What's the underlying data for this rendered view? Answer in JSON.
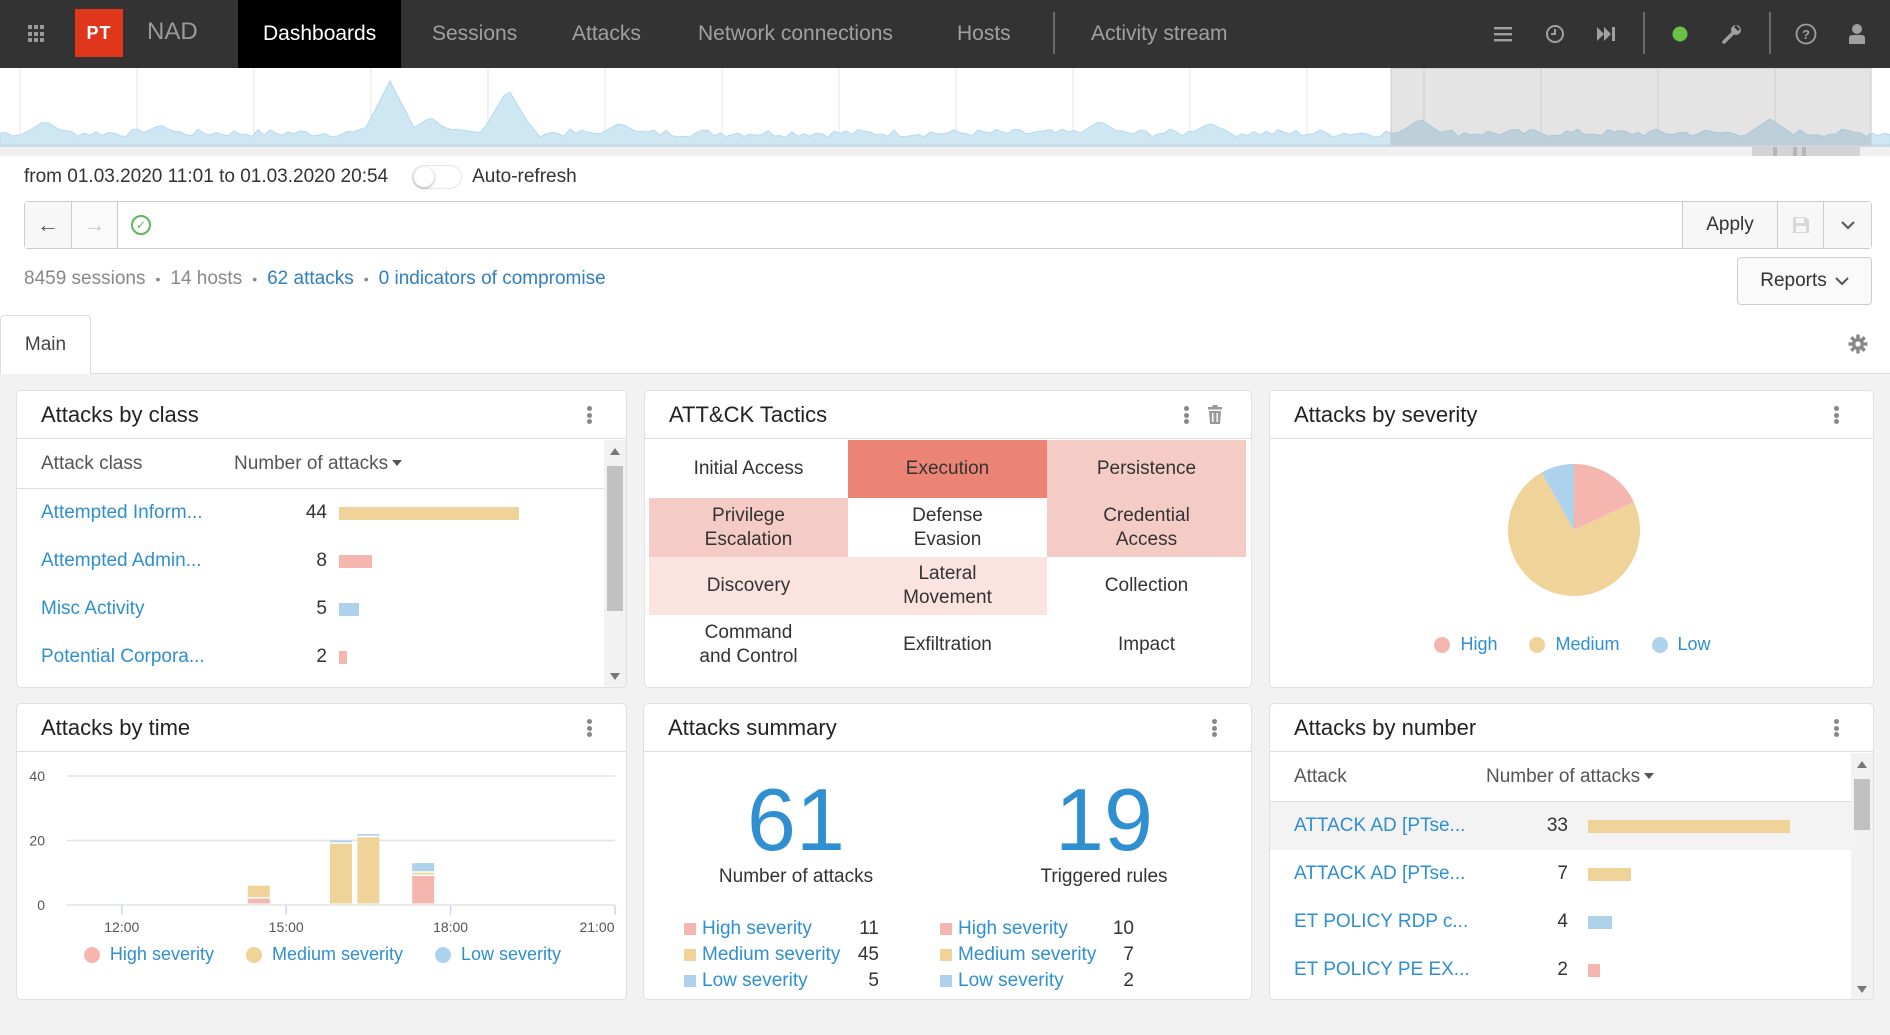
{
  "nav": {
    "app_name": "NAD",
    "logo_text": "PT",
    "tabs": [
      {
        "label": "Dashboards",
        "active": true
      },
      {
        "label": "Sessions",
        "active": false
      },
      {
        "label": "Attacks",
        "active": false
      },
      {
        "label": "Network connections",
        "active": false
      },
      {
        "label": "Hosts",
        "active": false
      },
      {
        "label": "Activity stream",
        "active": false
      }
    ],
    "icons": [
      "apps-grid-icon",
      "list-icon",
      "clock-icon",
      "skip-forward-icon",
      "status-online-icon",
      "wrench-icon",
      "help-icon",
      "user-icon"
    ],
    "status_color": "#5cb85c"
  },
  "timeline": {
    "description": "session activity overview with selected range highlighted"
  },
  "filter": {
    "date_range": "from 01.03.2020 11:01 to 01.03.2020 20:54",
    "auto_refresh_label": "Auto-refresh",
    "auto_refresh_on": false,
    "query_value": "",
    "query_placeholder": "",
    "apply_label": "Apply"
  },
  "stats": {
    "sessions": "8459 sessions",
    "hosts": "14 hosts",
    "attacks": "62 attacks",
    "ioc": "0 indicators of compromise"
  },
  "reports_label": "Reports",
  "tabs": [
    {
      "label": "Main",
      "active": true
    }
  ],
  "colors": {
    "high": "#f4b6ae",
    "medium": "#efd399",
    "low": "#aed2ec",
    "link": "#2f8fd0",
    "tactic_strong": "#eb8474",
    "tactic_mid": "#f5cbc5",
    "tactic_light": "#fbe3e0"
  },
  "panels": {
    "attacks_by_class": {
      "title": "Attacks by class",
      "col1": "Attack class",
      "col2": "Number of attacks",
      "rows": [
        {
          "name": "Attempted Inform...",
          "value": 44,
          "severity": "medium"
        },
        {
          "name": "Attempted Admin...",
          "value": 8,
          "severity": "high"
        },
        {
          "name": "Misc Activity",
          "value": 5,
          "severity": "low"
        },
        {
          "name": "Potential Corpora...",
          "value": 2,
          "severity": "high"
        }
      ]
    },
    "attck_tactics": {
      "title": "ATT&CK Tactics",
      "cells": [
        {
          "label": "Initial Access",
          "level": "none"
        },
        {
          "label": "Execution",
          "level": "strong"
        },
        {
          "label": "Persistence",
          "level": "mid"
        },
        {
          "label": "Privilege\nEscalation",
          "level": "mid"
        },
        {
          "label": "Defense\nEvasion",
          "level": "none"
        },
        {
          "label": "Credential\nAccess",
          "level": "mid"
        },
        {
          "label": "Discovery",
          "level": "light"
        },
        {
          "label": "Lateral\nMovement",
          "level": "light"
        },
        {
          "label": "Collection",
          "level": "none"
        },
        {
          "label": "Command\nand Control",
          "level": "none"
        },
        {
          "label": "Exfiltration",
          "level": "none"
        },
        {
          "label": "Impact",
          "level": "none"
        }
      ]
    },
    "attacks_by_severity": {
      "title": "Attacks by severity"
    },
    "attacks_by_time": {
      "title": "Attacks by time"
    },
    "attacks_summary": {
      "title": "Attacks summary",
      "attacks_total": "61",
      "attacks_label": "Number of attacks",
      "rules_total": "19",
      "rules_label": "Triggered rules",
      "attacks_breakdown": [
        {
          "label": "High severity",
          "value": "11",
          "severity": "high"
        },
        {
          "label": "Medium severity",
          "value": "45",
          "severity": "medium"
        },
        {
          "label": "Low severity",
          "value": "5",
          "severity": "low"
        }
      ],
      "rules_breakdown": [
        {
          "label": "High severity",
          "value": "10",
          "severity": "high"
        },
        {
          "label": "Medium severity",
          "value": "7",
          "severity": "medium"
        },
        {
          "label": "Low severity",
          "value": "2",
          "severity": "low"
        }
      ]
    },
    "attacks_by_number": {
      "title": "Attacks by number",
      "col1": "Attack",
      "col2": "Number of attacks",
      "rows": [
        {
          "name": "ATTACK AD [PTse...",
          "value": 33,
          "severity": "medium",
          "highlighted": true
        },
        {
          "name": "ATTACK AD [PTse...",
          "value": 7,
          "severity": "medium",
          "highlighted": false
        },
        {
          "name": "ET POLICY RDP c...",
          "value": 4,
          "severity": "low",
          "highlighted": false
        },
        {
          "name": "ET POLICY PE EX...",
          "value": 2,
          "severity": "high",
          "highlighted": false
        }
      ]
    }
  },
  "chart_data": [
    {
      "type": "pie",
      "title": "Attacks by severity",
      "categories": [
        "High",
        "Medium",
        "Low"
      ],
      "values": [
        11,
        45,
        5
      ],
      "colors": [
        "#f4b6ae",
        "#efd399",
        "#aed2ec"
      ],
      "legend": "bottom"
    },
    {
      "type": "bar",
      "stacked": true,
      "title": "Attacks by time",
      "xlabel": "",
      "ylabel": "",
      "x_ticks": [
        "12:00",
        "15:00",
        "18:00",
        "21:00"
      ],
      "y_ticks": [
        0,
        20,
        40
      ],
      "ylim": [
        0,
        40
      ],
      "xlim_hours": [
        11.0,
        21.0
      ],
      "x": [
        14.5,
        16.0,
        16.5,
        17.5
      ],
      "series": [
        {
          "name": "High severity",
          "color": "#f4b6ae",
          "values": [
            2,
            0,
            0,
            9
          ]
        },
        {
          "name": "Medium severity",
          "color": "#efd399",
          "values": [
            4,
            19,
            21,
            1
          ]
        },
        {
          "name": "Low severity",
          "color": "#aed2ec",
          "values": [
            0,
            1,
            1,
            3
          ]
        }
      ],
      "grid": true,
      "legend": "bottom"
    }
  ]
}
